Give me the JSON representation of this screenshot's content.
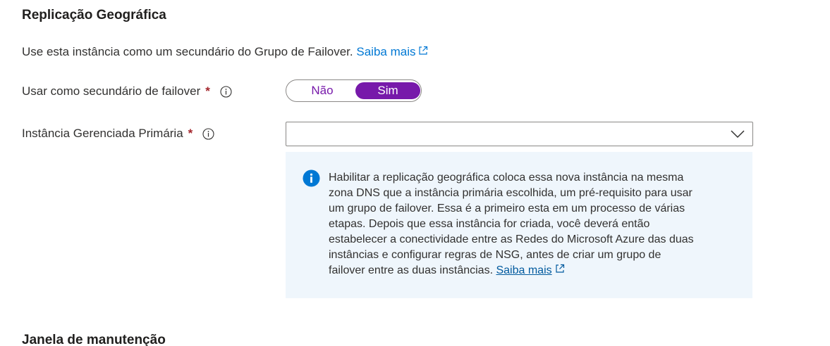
{
  "geo_replication": {
    "title": "Replicação Geográfica",
    "intro_text": "Use esta instância como um secundário do Grupo de Failover.",
    "intro_link": "Saiba mais"
  },
  "failover_secondary": {
    "label": "Usar como secundário de failover",
    "required_marker": "*",
    "options": [
      "Não",
      "Sim"
    ],
    "selected": "Sim"
  },
  "primary_instance": {
    "label": "Instância Gerenciada Primária",
    "required_marker": "*",
    "value": ""
  },
  "info_box": {
    "lines": [
      "Habilitar a replicação geográfica coloca essa nova instância na mesma",
      "zona DNS que a instância primária escolhida, um pré-requisito para usar",
      "um grupo de failover. Essa é a primeiro esta em um processo de várias",
      "etapas. Depois que essa instância for criada, você deverá então",
      "estabelecer a conectividade entre as Redes do Microsoft Azure das duas",
      "instâncias e configurar regras de NSG, antes de criar um grupo de",
      "failover entre as duas instâncias."
    ],
    "link": "Saiba mais"
  },
  "maintenance": {
    "title": "Janela de manutenção"
  },
  "colors": {
    "accent_purple": "#7719aa",
    "link_blue": "#0078d4",
    "info_bg": "#eff6fc",
    "required_red": "#a4262c"
  }
}
